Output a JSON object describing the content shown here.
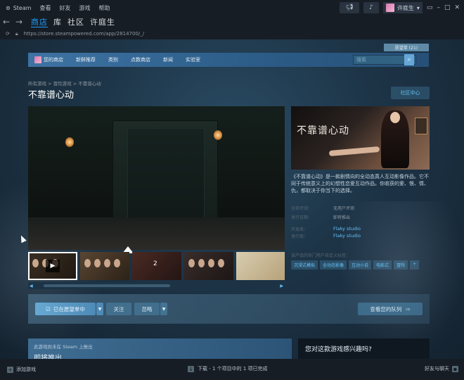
{
  "titlebar": {
    "app_name": "Steam",
    "menu": [
      "查看",
      "好友",
      "游戏",
      "帮助"
    ],
    "username": "许庭生"
  },
  "nav": {
    "tabs": [
      "商店",
      "库",
      "社区",
      "许庭生"
    ],
    "active_tab_index": 0
  },
  "address": {
    "url": "https://store.steampowered.com/app/2814700/_/"
  },
  "store": {
    "wishlist_count_label": "愿望单 (21)",
    "menu": [
      "您的商店",
      "新鲜推荐",
      "类别",
      "点数商店",
      "新闻",
      "实验室"
    ],
    "search_placeholder": "搜索"
  },
  "game": {
    "breadcrumb": [
      "所有游戏",
      "冒险游戏",
      "不靠谱心动"
    ],
    "breadcrumb_sep": ">",
    "title": "不靠谱心动",
    "community_hub_label": "社区中心",
    "capsule_logo": "不靠谱心动",
    "description": "《不靠谱心动》是一款剧情向的全动态真人互动影像作品。它不同于传统意义上的幻想性恋爱互动作品。你收获的爱、恨、情、仇，都取决于你当下的选择。",
    "reviews_label": "全部评测：",
    "reviews_value": "无用户评测",
    "release_label": "发行日期：",
    "release_value": "即将推出",
    "developer_label": "开发商：",
    "developer_value": "Flaky studio",
    "publisher_label": "发行商：",
    "publisher_value": "Flaky studio",
    "tags_label": "该产品的热门用户自定义标签：",
    "tags": [
      "沉浸式模拟",
      "全动态影像",
      "互动小说",
      "电影式",
      "冒险"
    ],
    "tags_more": "+",
    "thumbnail_number": "2"
  },
  "actions": {
    "wishlist_label": "已在愿望单中",
    "follow_label": "关注",
    "ignore_label": "忽略",
    "queue_label": "查看您的队列"
  },
  "coming_soon": {
    "notice": "此游戏尚未在 Steam 上推出",
    "heading": "即将推出",
    "interest_question": "您对这款游戏感兴趣吗?"
  },
  "bottombar": {
    "add_game": "添加游戏",
    "downloads": "下载 - 1 个项目中的 1 项已完成",
    "friends": "好友与聊天"
  },
  "colors": {
    "accent": "#1a9fff",
    "link": "#67c1f5",
    "background": "#1b2838"
  }
}
